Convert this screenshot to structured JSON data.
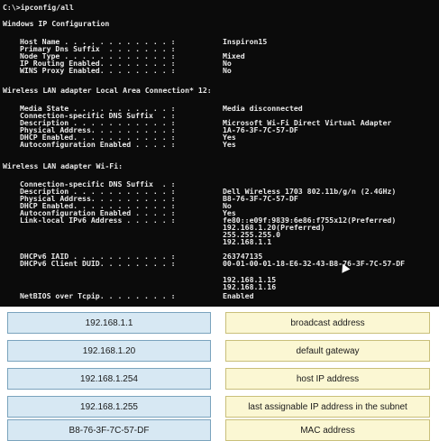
{
  "console": {
    "prompt": "C:\\>ipconfig/all",
    "title": "Windows IP Configuration",
    "general": [
      {
        "key": "Host Name . . . . . . . . . . . . :",
        "value": "Inspiron15"
      },
      {
        "key": "Primary Dns Suffix  . . . . . . . :",
        "value": ""
      },
      {
        "key": "Node Type . . . . . . . . . . . . :",
        "value": "Mixed"
      },
      {
        "key": "IP Routing Enabled. . . . . . . . :",
        "value": "No"
      },
      {
        "key": "WINS Proxy Enabled. . . . . . . . :",
        "value": "No"
      }
    ],
    "adapter1_title": "Wireless LAN adapter Local Area Connection* 12:",
    "adapter1": [
      {
        "key": "Media State . . . . . . . . . . . :",
        "value": "Media disconnected"
      },
      {
        "key": "Connection-specific DNS Suffix  . :",
        "value": ""
      },
      {
        "key": "Description . . . . . . . . . . . :",
        "value": "Microsoft Wi-Fi Direct Virtual Adapter"
      },
      {
        "key": "Physical Address. . . . . . . . . :",
        "value": "1A-76-3F-7C-57-DF"
      },
      {
        "key": "DHCP Enabled. . . . . . . . . . . :",
        "value": "Yes"
      },
      {
        "key": "Autoconfiguration Enabled . . . . :",
        "value": "Yes"
      }
    ],
    "adapter2_title": "Wireless LAN adapter Wi-Fi:",
    "adapter2": [
      {
        "key": "Connection-specific DNS Suffix  . :",
        "value": ""
      },
      {
        "key": "Description . . . . . . . . . . . :",
        "value": "Dell Wireless 1703 802.11b/g/n (2.4GHz)"
      },
      {
        "key": "Physical Address. . . . . . . . . :",
        "value": "B8-76-3F-7C-57-DF"
      },
      {
        "key": "DHCP Enabled. . . . . . . . . . . :",
        "value": "No"
      },
      {
        "key": "Autoconfiguration Enabled . . . . :",
        "value": "Yes"
      },
      {
        "key": "Link-local IPv6 Address . . . . . :",
        "value": "fe80::e09f:9839:6e86:f755x12(Preferred)"
      },
      {
        "key": "",
        "value": "192.168.1.20(Preferred)"
      },
      {
        "key": "",
        "value": "255.255.255.0"
      },
      {
        "key": "",
        "value": "192.168.1.1"
      },
      {
        "key": "DHCPv6 IAID . . . . . . . . . . . :",
        "value": "263747135"
      },
      {
        "key": "DHCPv6 Client DUID. . . . . . . . :",
        "value": "00-01-00-01-18-E6-32-43-B8-76-3F-7C-57-DF"
      },
      {
        "key": "",
        "value": "192.168.1.15"
      },
      {
        "key": "",
        "value": "192.168.1.16"
      },
      {
        "key": "NetBIOS over Tcpip. . . . . . . . :",
        "value": "Enabled"
      }
    ]
  },
  "left_tiles": [
    "192.168.1.1",
    "192.168.1.20",
    "192.168.1.254",
    "192.168.1.255",
    "B8-76-3F-7C-57-DF"
  ],
  "right_tiles": [
    "broadcast address",
    "default gateway",
    "host IP address",
    "last assignable IP address in the subnet",
    "MAC address"
  ],
  "colors": {
    "left_tile_bg": "#d7e8f3",
    "right_tile_bg": "#fbf7d3",
    "console_bg": "#0b0b0b"
  },
  "icons": {
    "pointer": "mouse-cursor-icon"
  }
}
